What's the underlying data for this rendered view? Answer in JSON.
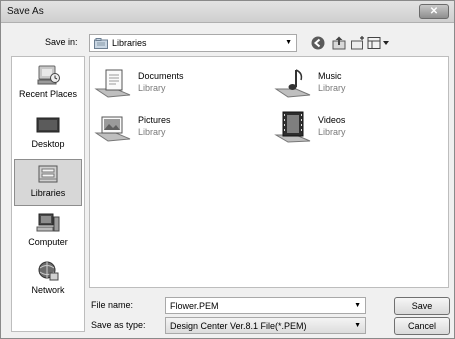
{
  "window": {
    "title": "Save As"
  },
  "close_glyph": "✕",
  "save_in": {
    "label": "Save in:",
    "value": "Libraries"
  },
  "toolbar": [
    "back-icon",
    "up-folder-icon",
    "new-folder-icon",
    "views-menu-icon"
  ],
  "places": [
    {
      "label": "Recent Places",
      "icon": "recent-places-icon"
    },
    {
      "label": "Desktop",
      "icon": "desktop-icon"
    },
    {
      "label": "Libraries",
      "icon": "libraries-icon",
      "selected": true
    },
    {
      "label": "Computer",
      "icon": "computer-icon"
    },
    {
      "label": "Network",
      "icon": "network-icon"
    }
  ],
  "files": [
    {
      "name": "Documents",
      "type": "Library",
      "icon": "documents-library-icon"
    },
    {
      "name": "Music",
      "type": "Library",
      "icon": "music-library-icon"
    },
    {
      "name": "Pictures",
      "type": "Library",
      "icon": "pictures-library-icon"
    },
    {
      "name": "Videos",
      "type": "Library",
      "icon": "videos-library-icon"
    }
  ],
  "file_name": {
    "label": "File name:",
    "value": "Flower.PEM"
  },
  "save_as_type": {
    "label": "Save as type:",
    "value": "Design Center Ver.8.1 File(*.PEM)"
  },
  "buttons": {
    "save": "Save",
    "cancel": "Cancel"
  },
  "dropdown_glyph": "▼"
}
